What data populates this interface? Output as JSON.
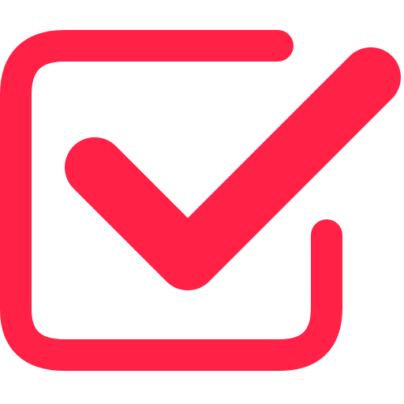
{
  "icon": {
    "name": "checkbox-checked-icon",
    "color": "#ff2146",
    "background": "#ffffff",
    "state": "checked"
  }
}
